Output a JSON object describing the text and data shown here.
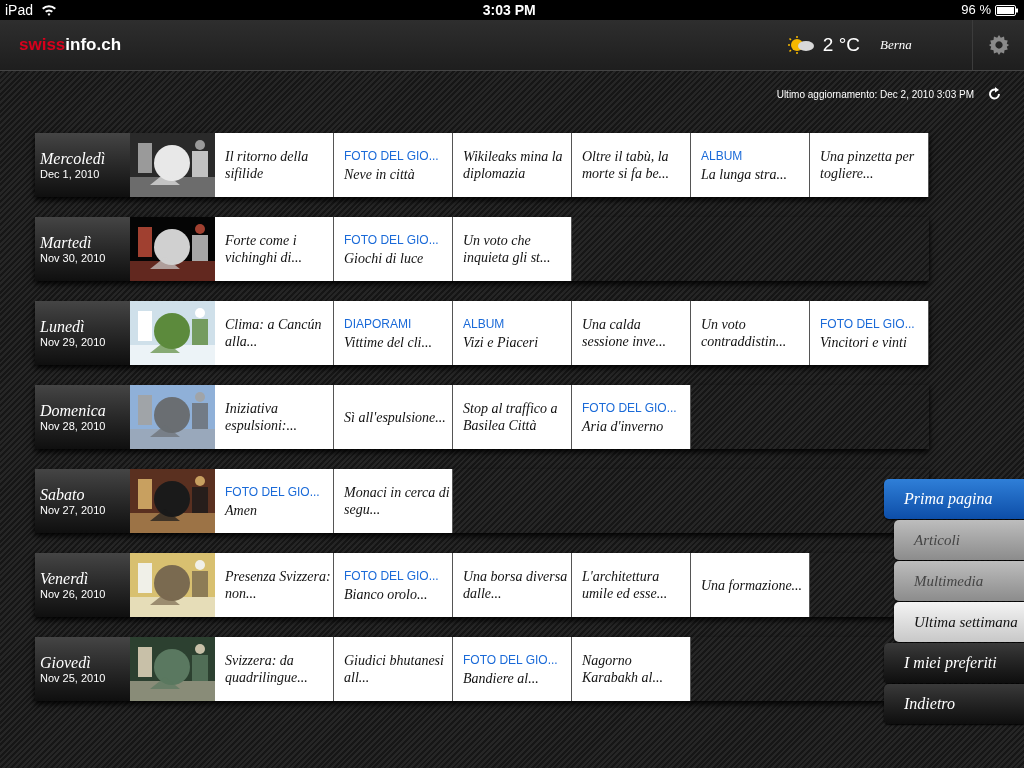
{
  "status_bar": {
    "device": "iPad",
    "time": "3:03 PM",
    "battery": "96 %"
  },
  "header": {
    "logo": {
      "red": "swiss",
      "white": "info.ch"
    },
    "temperature": "2 °C",
    "city": "Berna"
  },
  "last_update": "Ultimo aggiornamento: Dec 2, 2010 3:03 PM",
  "days": [
    {
      "day": "Mercoledì",
      "date": "Dec 1, 2010",
      "articles": [
        {
          "title": "Il ritorno della sifilide"
        },
        {
          "category": "FOTO DEL GIO...",
          "title": "Neve in città"
        },
        {
          "title": "Wikileaks mina la diplomazia"
        },
        {
          "title": "Oltre il tabù, la morte si fa be..."
        },
        {
          "category": "ALBUM",
          "title": "La lunga stra..."
        },
        {
          "title": "Una pinzetta per togliere..."
        }
      ]
    },
    {
      "day": "Martedì",
      "date": "Nov 30, 2010",
      "articles": [
        {
          "title": "Forte come i vichinghi di..."
        },
        {
          "category": "FOTO DEL GIO...",
          "title": "Giochi di luce"
        },
        {
          "title": "Un voto che inquieta gli st..."
        }
      ]
    },
    {
      "day": "Lunedì",
      "date": "Nov 29, 2010",
      "articles": [
        {
          "title": "Clima: a Cancún alla..."
        },
        {
          "category": "DIAPORAMI",
          "title": "Vittime del cli..."
        },
        {
          "category": "ALBUM",
          "title": "Vizi e Piaceri"
        },
        {
          "title": "Una calda sessione inve..."
        },
        {
          "title": "Un voto contraddistin..."
        },
        {
          "category": "FOTO DEL GIO...",
          "title": "Vincitori e vinti"
        }
      ]
    },
    {
      "day": "Domenica",
      "date": "Nov 28, 2010",
      "articles": [
        {
          "title": "Iniziativa espulsioni:..."
        },
        {
          "title": "Sì all'espulsione..."
        },
        {
          "title": "Stop al traffico a Basilea Città"
        },
        {
          "category": "FOTO DEL GIO...",
          "title": "Aria d'inverno"
        }
      ]
    },
    {
      "day": "Sabato",
      "date": "Nov 27, 2010",
      "articles": [
        {
          "category": "FOTO DEL GIO...",
          "title": "Amen"
        },
        {
          "title": "Monaci in cerca di segu..."
        }
      ]
    },
    {
      "day": "Venerdì",
      "date": "Nov 26, 2010",
      "articles": [
        {
          "title": "Presenza Svizzera: non..."
        },
        {
          "category": "FOTO DEL GIO...",
          "title": "Bianco orolo..."
        },
        {
          "title": "Una borsa diversa dalle..."
        },
        {
          "title": "L'architettura umile ed esse..."
        },
        {
          "title": "Una formazione..."
        }
      ]
    },
    {
      "day": "Giovedì",
      "date": "Nov 25, 2010",
      "articles": [
        {
          "title": "Svizzera: da quadrilingue..."
        },
        {
          "title": "Giudici bhutanesi all..."
        },
        {
          "category": "FOTO DEL GIO...",
          "title": "Bandiere al..."
        },
        {
          "title": "Nagorno Karabakh al..."
        }
      ]
    }
  ],
  "menu": [
    {
      "kind": "main",
      "label": "Prima pagina",
      "selected": true
    },
    {
      "kind": "sub",
      "label": "Articoli",
      "selected": false
    },
    {
      "kind": "sub",
      "label": "Multimedia",
      "selected": false
    },
    {
      "kind": "sub",
      "label": "Ultima settimana",
      "selected": true
    },
    {
      "kind": "main",
      "label": "I miei preferiti",
      "selected": false
    },
    {
      "kind": "main",
      "label": "Indietro",
      "selected": false
    }
  ]
}
